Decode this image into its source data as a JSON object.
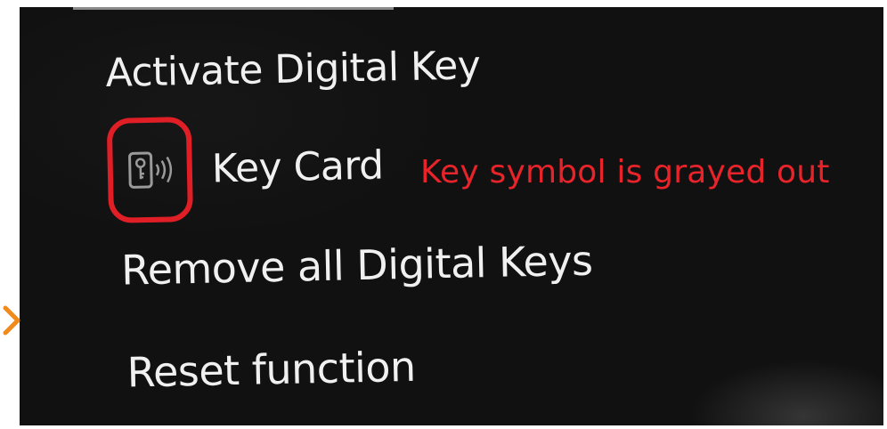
{
  "menu": {
    "items": [
      {
        "label": "Activate Digital Key"
      },
      {
        "label": "Key Card",
        "icon": "key-card-icon",
        "icon_state": "grayed out"
      },
      {
        "label": "Remove all Digital Keys"
      },
      {
        "label": "Reset function"
      }
    ],
    "selected_indicator": "chevron-right-icon"
  },
  "annotation": {
    "text": "Key symbol is grayed out",
    "color": "#e8232a"
  },
  "colors": {
    "background": "#111111",
    "text": "#f0f0f0",
    "highlight_ring": "#e01e25",
    "chevron": "#f08a1c",
    "icon_grayed": "#9a9a9a"
  }
}
